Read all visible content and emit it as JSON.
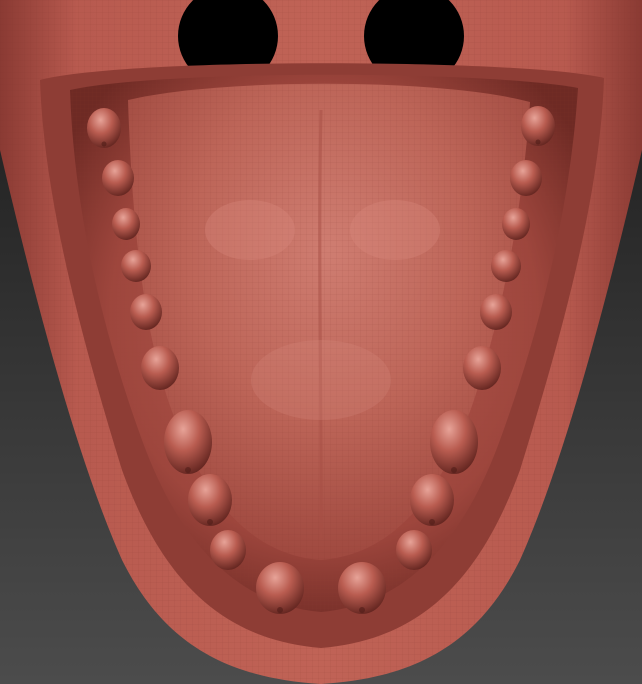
{
  "viewport": {
    "background_top": "#1c1c1c",
    "background_bottom": "#4a4a4a",
    "subject": "sculpted-mouth-mesh",
    "material_color": "#b4564c",
    "material_dark": "#6e2a24",
    "material_light": "#d88b80",
    "wireframe": true
  },
  "teeth": {
    "left_count": 10,
    "right_count": 10,
    "front_count": 2
  }
}
